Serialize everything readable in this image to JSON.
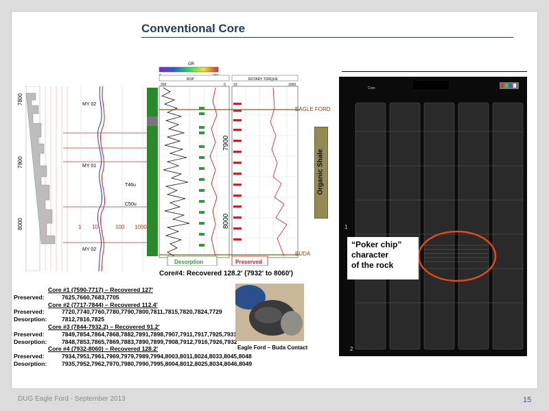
{
  "slide": {
    "title": "Conventional Core",
    "footer": "DUG Eagle Ford - September 2013",
    "page_number": "15"
  },
  "log": {
    "depths": [
      "7800",
      "7900",
      "8000"
    ],
    "track_labels": [
      "MY 02",
      "MY 01",
      "MY 02"
    ],
    "scale_labels": [
      "1",
      "10",
      "100",
      "1000"
    ],
    "misc_labels": [
      "T46u",
      "C50u"
    ],
    "gr_header": "GR",
    "gr_scale": [
      "0",
      "150"
    ],
    "rop_header": "ROP",
    "rop_scale": [
      "250",
      "0"
    ],
    "torque_header": "ROTARY TORQUE",
    "torque_scale": [
      "10",
      "1000"
    ],
    "depth_mid": [
      "7900",
      "8000"
    ],
    "desorption_label": "Desorption",
    "preserved_label": "Preserved",
    "core4_caption": "Core#4:  Recovered 128.2'  (7932' to 8060')",
    "formation_top": "EAGLE FORD",
    "formation_bottom": "BUDA",
    "organic_label": "Organic Shale",
    "colors": {
      "eagle_ford_line": "#8b5a1e",
      "desorption": "#2e9b3a",
      "preserved": "#d11f1f",
      "organic_box": "#948a54"
    }
  },
  "cores": [
    {
      "header": "Core #1 (7590-7717) – Recovered 127'",
      "rows": [
        {
          "label": "Preserved:",
          "values": "7625,7660,7683,7705"
        }
      ]
    },
    {
      "header": "Core #2 (7717-7844) – Recovered  112.4'",
      "rows": [
        {
          "label": "Preserved:",
          "values": "7720,7740,7760,7780,7790,7800,7811,7815,7820,7824,7729"
        },
        {
          "label": "Desorption:",
          "values": "7812,7816,7825"
        }
      ]
    },
    {
      "header": "Core #3 (7844-7932.2) – Recovered  91.2'",
      "rows": [
        {
          "label": "Preserved:",
          "values": "7849,7854,7864,7868,7882,7891,7898,7907,7911,7917,7925,7931"
        },
        {
          "label": "Desorption:",
          "values": "7848,7853,7865,7869,7883,7890,7899,7908,7912,7916,7926,7932"
        }
      ]
    },
    {
      "header": "Core #4 (7932-8060) – Recovered  128.2'",
      "rows": [
        {
          "label": "Preserved:",
          "values": "7934,7951,7961,7969,7979,7989,7994,8003,8011,8024,8033,8045,8048"
        },
        {
          "label": "Desorption:",
          "values": "7935,7952,7962,7970,7980,7990,7995,8004,8012,8025,8034,8046,8049"
        }
      ]
    }
  ],
  "sample_photo": {
    "caption": "Eagle Ford – Buda Contact"
  },
  "core_photo": {
    "callout": "“Poker chip” character of the rock",
    "callout_lines": [
      "“Poker chip”",
      "character",
      "of the rock"
    ],
    "header_label": "Core",
    "bottom_numbers": [
      "1",
      "2"
    ]
  }
}
